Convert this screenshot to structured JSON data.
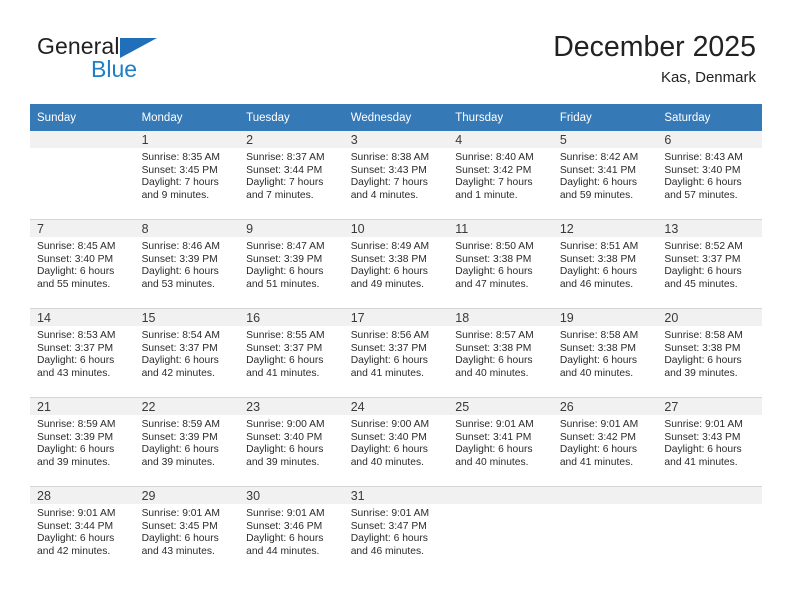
{
  "brand": {
    "name_part1": "General",
    "name_part2": "Blue",
    "triangle_color": "#1f6fba",
    "blue_color": "#1f7ec4"
  },
  "header": {
    "title": "December 2025",
    "subtitle": "Kas, Denmark"
  },
  "theme": {
    "header_blue": "#3579b6",
    "daynum_gray": "#f1f1f1",
    "grid_line": "#d5d5d5"
  },
  "calendar": {
    "weekday_headers": [
      "Sunday",
      "Monday",
      "Tuesday",
      "Wednesday",
      "Thursday",
      "Friday",
      "Saturday"
    ],
    "weeks": [
      [
        {
          "day": "",
          "lines": []
        },
        {
          "day": "1",
          "lines": [
            "Sunrise: 8:35 AM",
            "Sunset: 3:45 PM",
            "Daylight: 7 hours",
            "and 9 minutes."
          ]
        },
        {
          "day": "2",
          "lines": [
            "Sunrise: 8:37 AM",
            "Sunset: 3:44 PM",
            "Daylight: 7 hours",
            "and 7 minutes."
          ]
        },
        {
          "day": "3",
          "lines": [
            "Sunrise: 8:38 AM",
            "Sunset: 3:43 PM",
            "Daylight: 7 hours",
            "and 4 minutes."
          ]
        },
        {
          "day": "4",
          "lines": [
            "Sunrise: 8:40 AM",
            "Sunset: 3:42 PM",
            "Daylight: 7 hours",
            "and 1 minute."
          ]
        },
        {
          "day": "5",
          "lines": [
            "Sunrise: 8:42 AM",
            "Sunset: 3:41 PM",
            "Daylight: 6 hours",
            "and 59 minutes."
          ]
        },
        {
          "day": "6",
          "lines": [
            "Sunrise: 8:43 AM",
            "Sunset: 3:40 PM",
            "Daylight: 6 hours",
            "and 57 minutes."
          ]
        }
      ],
      [
        {
          "day": "7",
          "lines": [
            "Sunrise: 8:45 AM",
            "Sunset: 3:40 PM",
            "Daylight: 6 hours",
            "and 55 minutes."
          ]
        },
        {
          "day": "8",
          "lines": [
            "Sunrise: 8:46 AM",
            "Sunset: 3:39 PM",
            "Daylight: 6 hours",
            "and 53 minutes."
          ]
        },
        {
          "day": "9",
          "lines": [
            "Sunrise: 8:47 AM",
            "Sunset: 3:39 PM",
            "Daylight: 6 hours",
            "and 51 minutes."
          ]
        },
        {
          "day": "10",
          "lines": [
            "Sunrise: 8:49 AM",
            "Sunset: 3:38 PM",
            "Daylight: 6 hours",
            "and 49 minutes."
          ]
        },
        {
          "day": "11",
          "lines": [
            "Sunrise: 8:50 AM",
            "Sunset: 3:38 PM",
            "Daylight: 6 hours",
            "and 47 minutes."
          ]
        },
        {
          "day": "12",
          "lines": [
            "Sunrise: 8:51 AM",
            "Sunset: 3:38 PM",
            "Daylight: 6 hours",
            "and 46 minutes."
          ]
        },
        {
          "day": "13",
          "lines": [
            "Sunrise: 8:52 AM",
            "Sunset: 3:37 PM",
            "Daylight: 6 hours",
            "and 45 minutes."
          ]
        }
      ],
      [
        {
          "day": "14",
          "lines": [
            "Sunrise: 8:53 AM",
            "Sunset: 3:37 PM",
            "Daylight: 6 hours",
            "and 43 minutes."
          ]
        },
        {
          "day": "15",
          "lines": [
            "Sunrise: 8:54 AM",
            "Sunset: 3:37 PM",
            "Daylight: 6 hours",
            "and 42 minutes."
          ]
        },
        {
          "day": "16",
          "lines": [
            "Sunrise: 8:55 AM",
            "Sunset: 3:37 PM",
            "Daylight: 6 hours",
            "and 41 minutes."
          ]
        },
        {
          "day": "17",
          "lines": [
            "Sunrise: 8:56 AM",
            "Sunset: 3:37 PM",
            "Daylight: 6 hours",
            "and 41 minutes."
          ]
        },
        {
          "day": "18",
          "lines": [
            "Sunrise: 8:57 AM",
            "Sunset: 3:38 PM",
            "Daylight: 6 hours",
            "and 40 minutes."
          ]
        },
        {
          "day": "19",
          "lines": [
            "Sunrise: 8:58 AM",
            "Sunset: 3:38 PM",
            "Daylight: 6 hours",
            "and 40 minutes."
          ]
        },
        {
          "day": "20",
          "lines": [
            "Sunrise: 8:58 AM",
            "Sunset: 3:38 PM",
            "Daylight: 6 hours",
            "and 39 minutes."
          ]
        }
      ],
      [
        {
          "day": "21",
          "lines": [
            "Sunrise: 8:59 AM",
            "Sunset: 3:39 PM",
            "Daylight: 6 hours",
            "and 39 minutes."
          ]
        },
        {
          "day": "22",
          "lines": [
            "Sunrise: 8:59 AM",
            "Sunset: 3:39 PM",
            "Daylight: 6 hours",
            "and 39 minutes."
          ]
        },
        {
          "day": "23",
          "lines": [
            "Sunrise: 9:00 AM",
            "Sunset: 3:40 PM",
            "Daylight: 6 hours",
            "and 39 minutes."
          ]
        },
        {
          "day": "24",
          "lines": [
            "Sunrise: 9:00 AM",
            "Sunset: 3:40 PM",
            "Daylight: 6 hours",
            "and 40 minutes."
          ]
        },
        {
          "day": "25",
          "lines": [
            "Sunrise: 9:01 AM",
            "Sunset: 3:41 PM",
            "Daylight: 6 hours",
            "and 40 minutes."
          ]
        },
        {
          "day": "26",
          "lines": [
            "Sunrise: 9:01 AM",
            "Sunset: 3:42 PM",
            "Daylight: 6 hours",
            "and 41 minutes."
          ]
        },
        {
          "day": "27",
          "lines": [
            "Sunrise: 9:01 AM",
            "Sunset: 3:43 PM",
            "Daylight: 6 hours",
            "and 41 minutes."
          ]
        }
      ],
      [
        {
          "day": "28",
          "lines": [
            "Sunrise: 9:01 AM",
            "Sunset: 3:44 PM",
            "Daylight: 6 hours",
            "and 42 minutes."
          ]
        },
        {
          "day": "29",
          "lines": [
            "Sunrise: 9:01 AM",
            "Sunset: 3:45 PM",
            "Daylight: 6 hours",
            "and 43 minutes."
          ]
        },
        {
          "day": "30",
          "lines": [
            "Sunrise: 9:01 AM",
            "Sunset: 3:46 PM",
            "Daylight: 6 hours",
            "and 44 minutes."
          ]
        },
        {
          "day": "31",
          "lines": [
            "Sunrise: 9:01 AM",
            "Sunset: 3:47 PM",
            "Daylight: 6 hours",
            "and 46 minutes."
          ]
        },
        {
          "day": "",
          "lines": []
        },
        {
          "day": "",
          "lines": []
        },
        {
          "day": "",
          "lines": []
        }
      ]
    ]
  }
}
